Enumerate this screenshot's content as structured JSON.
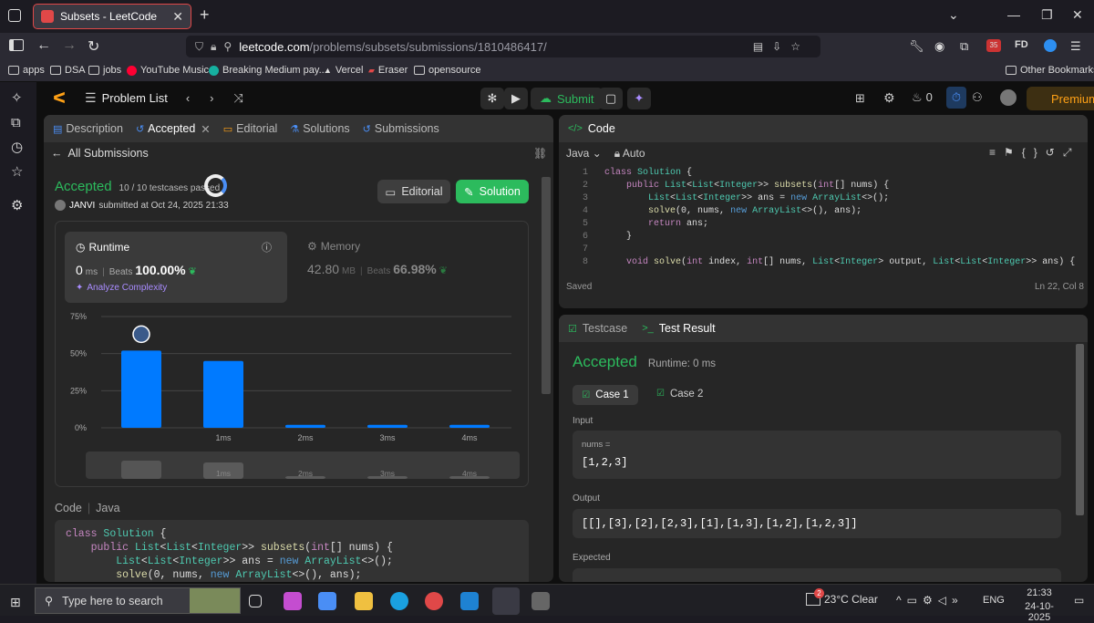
{
  "browser": {
    "tab_title": "Subsets - LeetCode",
    "url_host": "leetcode.com",
    "url_path": "/problems/subsets/submissions/1810486417/",
    "ext_badge": "35",
    "profile": "FD",
    "bookmarks": [
      "apps",
      "DSA",
      "jobs",
      "YouTube Music",
      "Breaking Medium pay...",
      "Vercel",
      "Eraser",
      "opensource"
    ],
    "other_bookmarks": "Other Bookmarks"
  },
  "header": {
    "problem_list": "Problem List",
    "submit": "Submit",
    "streak": "0",
    "premium": "Premium"
  },
  "left_tabs": [
    "Description",
    "Accepted",
    "Editorial",
    "Solutions",
    "Submissions"
  ],
  "submission": {
    "back": "All Submissions",
    "status": "Accepted",
    "testcases": "10 / 10 testcases passed",
    "user": "JANVI",
    "submitted": "submitted at Oct 24, 2025 21:33",
    "editorial_btn": "Editorial",
    "solution_btn": "Solution",
    "runtime_label": "Runtime",
    "runtime_value": "0",
    "runtime_unit": "ms",
    "beats_label": "Beats",
    "runtime_beats": "100.00%",
    "analyze": "Analyze Complexity",
    "memory_label": "Memory",
    "memory_value": "42.80",
    "memory_unit": "MB",
    "memory_beats": "66.98%",
    "code_label": "Code",
    "lang_label": "Java"
  },
  "chart_data": {
    "type": "bar",
    "categories": [
      "",
      "1ms",
      "2ms",
      "3ms",
      "4ms"
    ],
    "values": [
      52,
      45,
      2,
      2,
      2
    ],
    "ytick_labels": [
      "75%",
      "50%",
      "25%",
      "0%"
    ],
    "yticks": [
      75,
      50,
      25,
      0
    ],
    "ylim": [
      0,
      75
    ],
    "bar_color": "#007aff",
    "mini_values": [
      50,
      45,
      5,
      5,
      5
    ]
  },
  "code_panel": {
    "title": "Code",
    "lang": "Java",
    "mode": "Auto",
    "status": "Saved",
    "position": "Ln 22, Col 8"
  },
  "code_lines": [
    [
      {
        "c": "kw",
        "t": "class "
      },
      {
        "c": "ty",
        "t": "Solution"
      },
      {
        "c": "",
        "t": " {"
      }
    ],
    [
      {
        "c": "",
        "t": "    "
      },
      {
        "c": "kw",
        "t": "public "
      },
      {
        "c": "ty",
        "t": "List"
      },
      {
        "c": "",
        "t": "<"
      },
      {
        "c": "ty",
        "t": "List"
      },
      {
        "c": "",
        "t": "<"
      },
      {
        "c": "ty",
        "t": "Integer"
      },
      {
        "c": "",
        "t": ">> "
      },
      {
        "c": "fn",
        "t": "subsets"
      },
      {
        "c": "",
        "t": "("
      },
      {
        "c": "kw",
        "t": "int"
      },
      {
        "c": "",
        "t": "[] nums) {"
      }
    ],
    [
      {
        "c": "",
        "t": "        "
      },
      {
        "c": "ty",
        "t": "List"
      },
      {
        "c": "",
        "t": "<"
      },
      {
        "c": "ty",
        "t": "List"
      },
      {
        "c": "",
        "t": "<"
      },
      {
        "c": "ty",
        "t": "Integer"
      },
      {
        "c": "",
        "t": ">> ans = "
      },
      {
        "c": "nw",
        "t": "new "
      },
      {
        "c": "ty",
        "t": "ArrayList"
      },
      {
        "c": "",
        "t": "<>();"
      }
    ],
    [
      {
        "c": "",
        "t": "        "
      },
      {
        "c": "fn",
        "t": "solve"
      },
      {
        "c": "",
        "t": "(0, nums, "
      },
      {
        "c": "nw",
        "t": "new "
      },
      {
        "c": "ty",
        "t": "ArrayList"
      },
      {
        "c": "",
        "t": "<>(), ans);"
      }
    ],
    [
      {
        "c": "",
        "t": "        "
      },
      {
        "c": "kw",
        "t": "return "
      },
      {
        "c": "",
        "t": "ans;"
      }
    ],
    [
      {
        "c": "",
        "t": "    }"
      }
    ],
    [
      {
        "c": "",
        "t": ""
      }
    ],
    [
      {
        "c": "",
        "t": "    "
      },
      {
        "c": "kw",
        "t": "void "
      },
      {
        "c": "fn",
        "t": "solve"
      },
      {
        "c": "",
        "t": "("
      },
      {
        "c": "kw",
        "t": "int "
      },
      {
        "c": "",
        "t": "index, "
      },
      {
        "c": "kw",
        "t": "int"
      },
      {
        "c": "",
        "t": "[] nums, "
      },
      {
        "c": "ty",
        "t": "List"
      },
      {
        "c": "",
        "t": "<"
      },
      {
        "c": "ty",
        "t": "Integer"
      },
      {
        "c": "",
        "t": "> output, "
      },
      {
        "c": "ty",
        "t": "List"
      },
      {
        "c": "",
        "t": "<"
      },
      {
        "c": "ty",
        "t": "List"
      },
      {
        "c": "",
        "t": "<"
      },
      {
        "c": "ty",
        "t": "Integer"
      },
      {
        "c": "",
        "t": ">> ans) {"
      }
    ]
  ],
  "sub_code_lines": [
    [
      {
        "c": "kw",
        "t": "class "
      },
      {
        "c": "ty",
        "t": "Solution"
      },
      {
        "c": "",
        "t": " {"
      }
    ],
    [
      {
        "c": "",
        "t": "    "
      },
      {
        "c": "kw",
        "t": "public "
      },
      {
        "c": "ty",
        "t": "List"
      },
      {
        "c": "",
        "t": "<"
      },
      {
        "c": "ty",
        "t": "List"
      },
      {
        "c": "",
        "t": "<"
      },
      {
        "c": "ty",
        "t": "Integer"
      },
      {
        "c": "",
        "t": ">> "
      },
      {
        "c": "fn",
        "t": "subsets"
      },
      {
        "c": "",
        "t": "("
      },
      {
        "c": "kw",
        "t": "int"
      },
      {
        "c": "",
        "t": "[] nums) {"
      }
    ],
    [
      {
        "c": "",
        "t": "        "
      },
      {
        "c": "ty",
        "t": "List"
      },
      {
        "c": "",
        "t": "<"
      },
      {
        "c": "ty",
        "t": "List"
      },
      {
        "c": "",
        "t": "<"
      },
      {
        "c": "ty",
        "t": "Integer"
      },
      {
        "c": "",
        "t": ">> ans = "
      },
      {
        "c": "nw",
        "t": "new "
      },
      {
        "c": "ty",
        "t": "ArrayList"
      },
      {
        "c": "",
        "t": "<>();"
      }
    ],
    [
      {
        "c": "",
        "t": "        "
      },
      {
        "c": "fn",
        "t": "solve"
      },
      {
        "c": "",
        "t": "(0, nums, "
      },
      {
        "c": "nw",
        "t": "new "
      },
      {
        "c": "ty",
        "t": "ArrayList"
      },
      {
        "c": "",
        "t": "<>(), ans);"
      }
    ]
  ],
  "testpanel": {
    "testcase_tab": "Testcase",
    "result_tab": "Test Result",
    "status": "Accepted",
    "runtime": "Runtime: 0 ms",
    "case1": "Case 1",
    "case2": "Case 2",
    "input_label": "Input",
    "var_name": "nums =",
    "input_value": "[1,2,3]",
    "output_label": "Output",
    "output_value": "[[],[3],[2],[2,3],[1],[1,3],[1,2],[1,2,3]]",
    "expected_label": "Expected"
  },
  "taskbar": {
    "search_placeholder": "Type here to search",
    "weather": "23°C  Clear",
    "weather_badge": "2",
    "lang": "ENG",
    "time": "21:33",
    "date": "24-10-2025"
  }
}
